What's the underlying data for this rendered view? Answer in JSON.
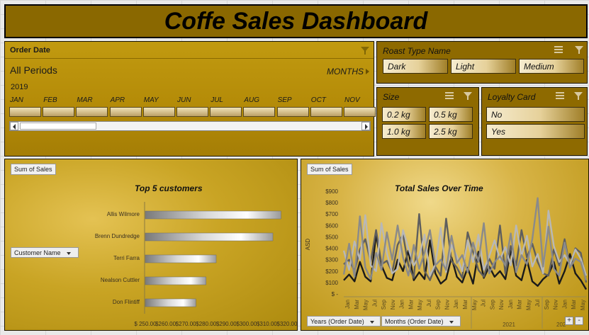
{
  "title": "Coffe Sales Dashboard",
  "timeline": {
    "caption": "Order Date",
    "period": "All Periods",
    "level": "MONTHS",
    "year": "2019",
    "months": [
      "JAN",
      "FEB",
      "MAR",
      "APR",
      "MAY",
      "JUN",
      "JUL",
      "AUG",
      "SEP",
      "OCT",
      "NOV"
    ]
  },
  "roast": {
    "caption": "Roast Type Name",
    "items": [
      "Dark",
      "Light",
      "Medium"
    ]
  },
  "size": {
    "caption": "Size",
    "items": [
      "0.2 kg",
      "0.5 kg",
      "1.0 kg",
      "2.5 kg"
    ]
  },
  "loyalty": {
    "caption": "Loyalty Card",
    "items": [
      "No",
      "Yes"
    ]
  },
  "top_customers": {
    "field_button": "Sum of Sales",
    "title": "Top 5 customers",
    "filter_button": "Customer Name"
  },
  "sales_time": {
    "field_button": "Sum of Sales",
    "title": "Total Sales Over Time",
    "ylabel": "ASD",
    "years_button": "Years (Order Date)",
    "months_button": "Months (Order Date)",
    "year_label_2021": "2021",
    "year_label_2022": "202"
  },
  "colors": {
    "gold": "#b48b08",
    "brown": "#8e6a00",
    "title_bg": "#8a6800"
  },
  "chart_data": [
    {
      "type": "bar",
      "title": "Top 5 customers",
      "categories": [
        "Allis Wilmore",
        "Brenn Dundredge",
        "Terri Farra",
        "Nealson Cuttler",
        "Don Flintiff"
      ],
      "values": [
        317,
        313,
        285,
        280,
        275
      ],
      "xlim": [
        250,
        320
      ],
      "xticks": [
        "$ 250.00",
        "$260.00",
        "$270.00",
        "$280.00",
        "$290.00",
        "$300.00",
        "$310.00",
        "$320.00"
      ]
    },
    {
      "type": "line",
      "title": "Total Sales Over Time",
      "ylabel": "ASD",
      "ylim": [
        0,
        900
      ],
      "yticks": [
        "$ -",
        "$100",
        "$200",
        "$300",
        "$400",
        "$500",
        "$600",
        "$700",
        "$800",
        "$900"
      ],
      "x": [
        "Jan",
        "Mar",
        "May",
        "Jul",
        "Sep",
        "Nov",
        "Jan",
        "Mar",
        "May",
        "Jul",
        "Sep",
        "Nov",
        "Jan",
        "Mar",
        "May",
        "Jul",
        "Sep",
        "Nov",
        "Jan",
        "Mar",
        "May",
        "Jul",
        "Sep",
        "Nov",
        "Jan",
        "Mar",
        "May"
      ],
      "series": [
        {
          "color": "#1a1a1a",
          "values": [
            120,
            170,
            110,
            280,
            150,
            110,
            520,
            250,
            140,
            120,
            300,
            200,
            380,
            120,
            190,
            130,
            470,
            180,
            90,
            130,
            320,
            150,
            100,
            230,
            90,
            370,
            140,
            240,
            150,
            200,
            130,
            380,
            160,
            120,
            300,
            110,
            70,
            130,
            170,
            280,
            90,
            200,
            350,
            180,
            120,
            40
          ]
        },
        {
          "color": "#5e5e5e",
          "values": [
            260,
            300,
            200,
            390,
            480,
            280,
            560,
            260,
            290,
            190,
            430,
            520,
            250,
            140,
            700,
            200,
            120,
            240,
            160,
            660,
            290,
            230,
            140,
            540,
            370,
            210,
            150,
            310,
            220,
            600,
            180,
            420,
            250,
            560,
            320,
            440,
            280,
            180,
            160,
            390,
            250,
            480,
            230,
            400,
            360,
            100
          ]
        },
        {
          "color": "#b8b8b8",
          "values": [
            380,
            210,
            460,
            300,
            690,
            250,
            200,
            620,
            360,
            180,
            220,
            560,
            400,
            250,
            330,
            520,
            160,
            260,
            580,
            190,
            430,
            330,
            200,
            470,
            280,
            520,
            210,
            330,
            470,
            300,
            410,
            250,
            600,
            330,
            510,
            240,
            350,
            180,
            730,
            420,
            280,
            340,
            260,
            390,
            310,
            160
          ]
        },
        {
          "color": "#8a8a8a",
          "values": [
            170,
            440,
            150,
            680,
            230,
            130,
            360,
            210,
            540,
            300,
            600,
            320,
            160,
            430,
            220,
            360,
            560,
            250,
            300,
            210,
            510,
            270,
            340,
            190,
            450,
            280,
            620,
            180,
            280,
            330,
            250,
            530,
            190,
            340,
            260,
            480,
            840,
            240,
            590,
            220,
            160,
            450,
            230,
            310,
            280,
            120
          ]
        }
      ]
    }
  ]
}
